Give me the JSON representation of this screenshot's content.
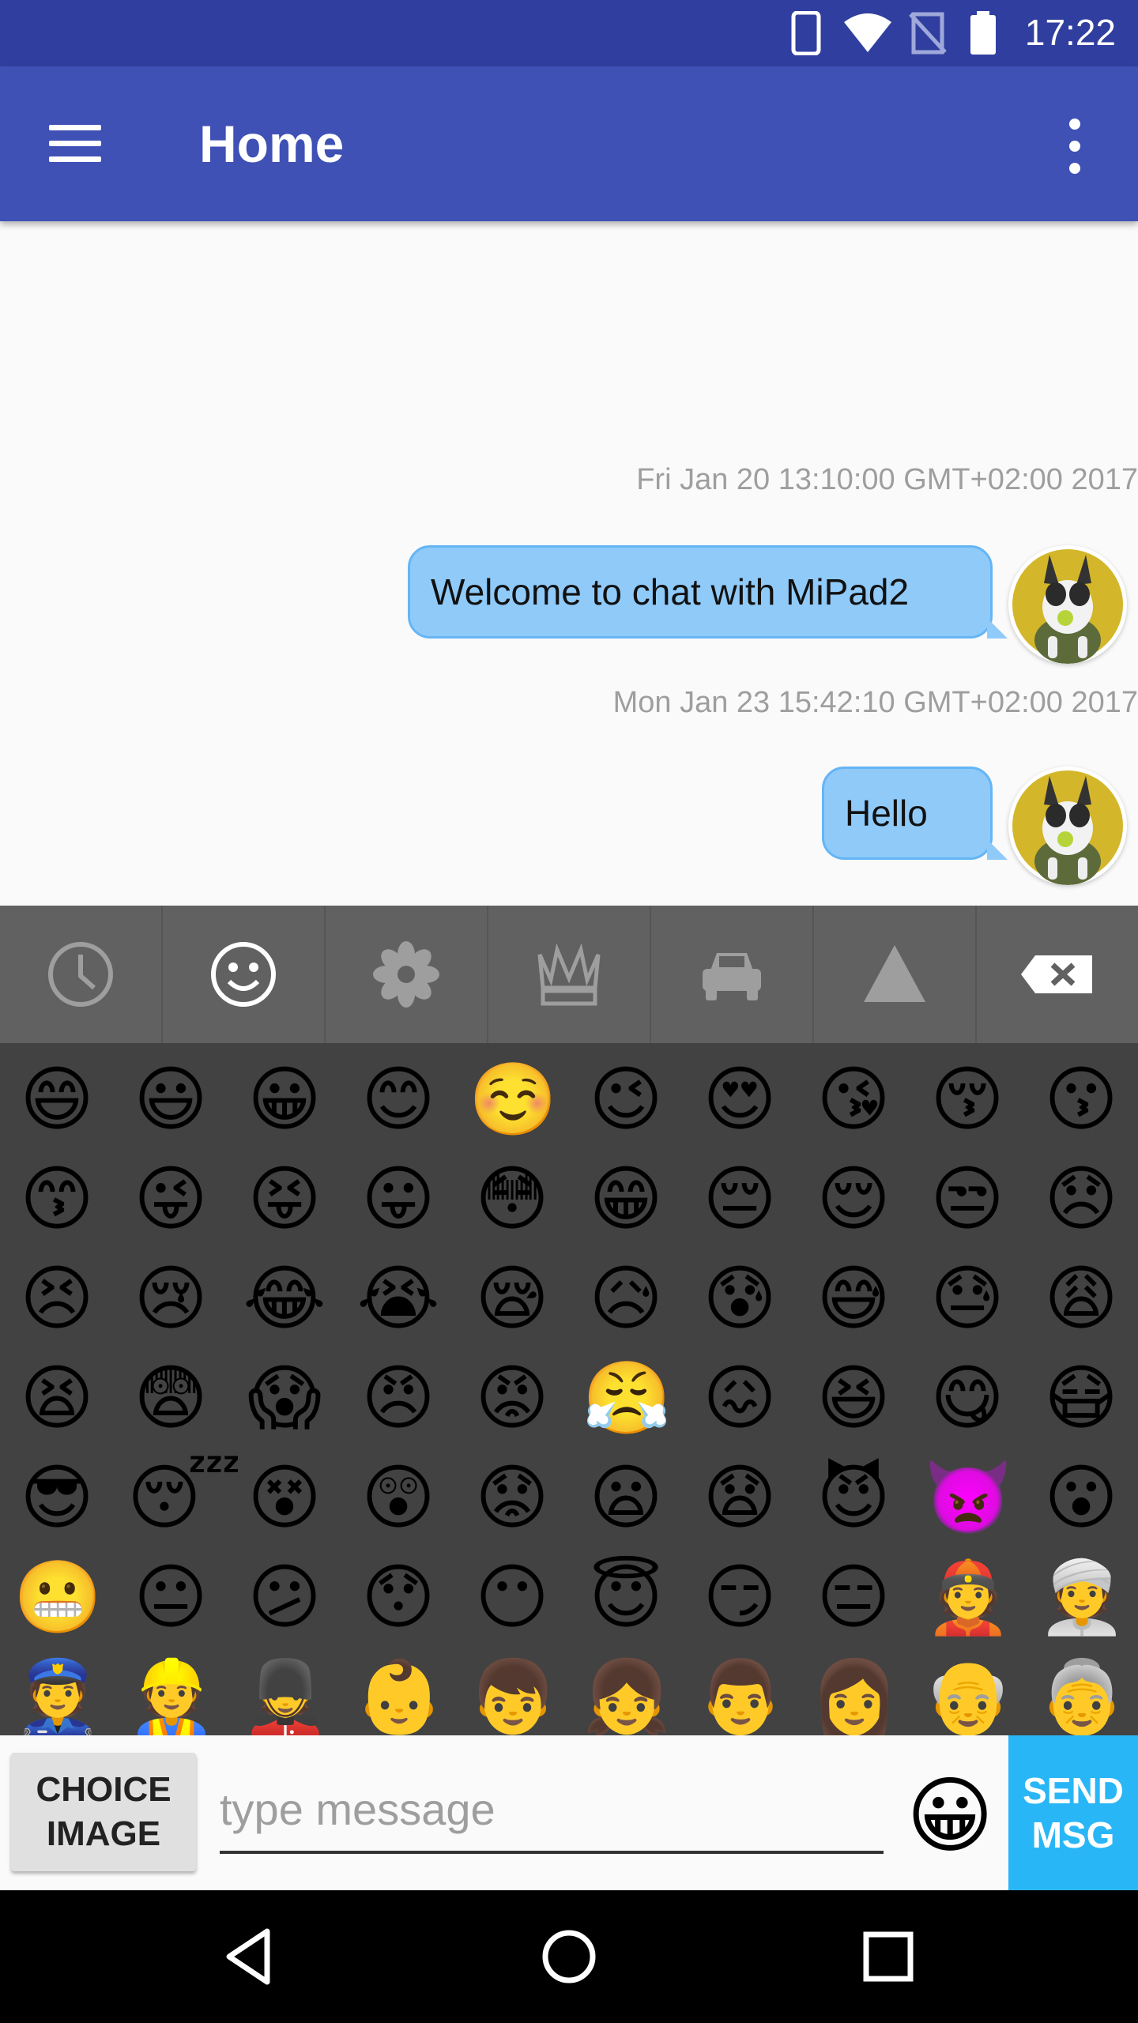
{
  "status_bar": {
    "time": "17:22"
  },
  "app_bar": {
    "title": "Home"
  },
  "chat": {
    "messages": [
      {
        "timestamp": "Fri Jan 20 13:10:00 GMT+02:00 2017",
        "text": "Welcome to chat with MiPad2"
      },
      {
        "timestamp": "Mon Jan 23 15:42:10 GMT+02:00 2017",
        "text": "Hello"
      }
    ]
  },
  "emoji_keyboard": {
    "tabs": [
      "recent-icon",
      "smiley-icon",
      "flower-icon",
      "crown-icon",
      "car-icon",
      "triangle-icon",
      "backspace-icon"
    ],
    "selected_tab": "smiley-icon",
    "rows": [
      [
        "😄",
        "😃",
        "😀",
        "😊",
        "☺️",
        "😉",
        "😍",
        "😘",
        "😚",
        "😗"
      ],
      [
        "😙",
        "😜",
        "😝",
        "😛",
        "😳",
        "😁",
        "😔",
        "😌",
        "😒",
        "😞"
      ],
      [
        "😣",
        "😢",
        "😂",
        "😭",
        "😪",
        "😥",
        "😰",
        "😅",
        "😓",
        "😩"
      ],
      [
        "😫",
        "😨",
        "😱",
        "😠",
        "😡",
        "😤",
        "😖",
        "😆",
        "😋",
        "😷"
      ],
      [
        "😎",
        "😴",
        "😵",
        "😲",
        "😟",
        "😦",
        "😧",
        "😈",
        "👿",
        "😮"
      ],
      [
        "😬",
        "😐",
        "😕",
        "😯",
        "😶",
        "😇",
        "😏",
        "😑",
        "👲",
        "👳"
      ],
      [
        "👮",
        "👷",
        "💂",
        "👶",
        "👦",
        "👧",
        "👨",
        "👩",
        "👴",
        "👵"
      ]
    ]
  },
  "input_bar": {
    "choice_image_label": "CHOICE\nIMAGE",
    "message_placeholder": "type message",
    "message_value": "",
    "emoji_button": "😀",
    "send_label": "SEND\nMSG"
  }
}
